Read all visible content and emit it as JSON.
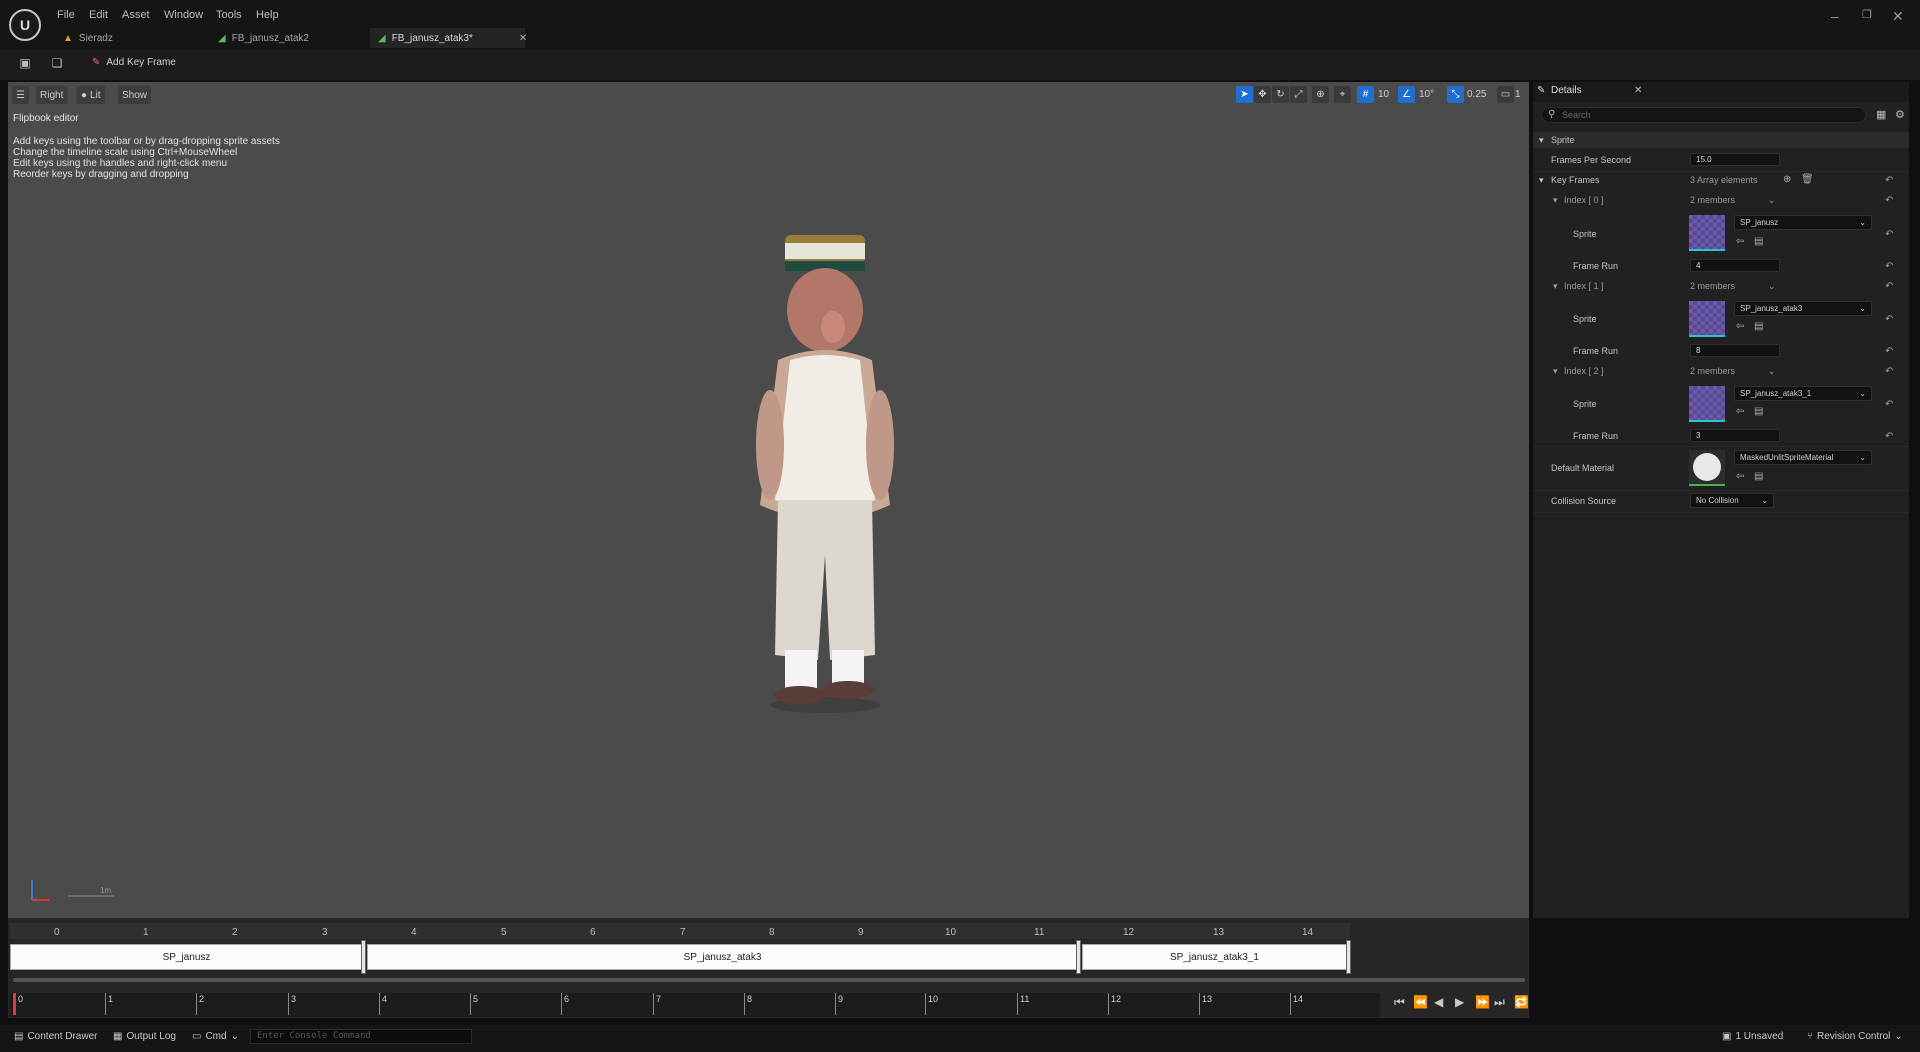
{
  "menu": [
    "File",
    "Edit",
    "Asset",
    "Window",
    "Tools",
    "Help"
  ],
  "tabs": [
    {
      "label": "Sieradz",
      "icon": "level-icon"
    },
    {
      "label": "FB_janusz_atak2",
      "icon": "flipbook-icon"
    },
    {
      "label": "FB_janusz_atak3*",
      "icon": "flipbook-icon",
      "active": true
    }
  ],
  "toolbar": {
    "add_key_frame": "Add Key Frame"
  },
  "viewport": {
    "view_mode": "Right",
    "lighting": "Lit",
    "show": "Show",
    "grid_snap": "10",
    "rotation_snap": "10°",
    "scale_snap": "0.25",
    "camera_speed": "1",
    "title": "Flipbook editor",
    "help_lines": [
      "Add keys using the toolbar or by drag-dropping sprite assets",
      "Change the timeline scale using Ctrl+MouseWheel",
      "Edit keys using the handles and right-click menu",
      "Reorder keys by dragging and dropping"
    ],
    "scale_label": "1m"
  },
  "details": {
    "title": "Details",
    "search_placeholder": "Search",
    "category": "Sprite",
    "fps_label": "Frames Per Second",
    "fps_value": "15.0",
    "key_frames_label": "Key Frames",
    "key_frames_count": "3 Array elements",
    "members": "2 members",
    "sprite_label": "Sprite",
    "frame_run_label": "Frame Run",
    "entries": [
      {
        "index": "Index [ 0 ]",
        "sprite": "SP_janusz",
        "frame_run": "4"
      },
      {
        "index": "Index [ 1 ]",
        "sprite": "SP_janusz_atak3",
        "frame_run": "8"
      },
      {
        "index": "Index [ 2 ]",
        "sprite": "SP_janusz_atak3_1",
        "frame_run": "3"
      }
    ],
    "default_material_label": "Default Material",
    "default_material_value": "MaskedUnlitSpriteMaterial",
    "collision_label": "Collision Source",
    "collision_value": "No Collision"
  },
  "timeline": {
    "frames": [
      "0",
      "1",
      "2",
      "3",
      "4",
      "5",
      "6",
      "7",
      "8",
      "9",
      "10",
      "11",
      "12",
      "13",
      "14"
    ],
    "keys": [
      "SP_janusz",
      "SP_janusz_atak3",
      "SP_janusz_atak3_1"
    ],
    "ruler": [
      "0",
      "1",
      "2",
      "3",
      "4",
      "5",
      "6",
      "7",
      "8",
      "9",
      "10",
      "11",
      "12",
      "13",
      "14"
    ]
  },
  "status": {
    "content_drawer": "Content Drawer",
    "output_log": "Output Log",
    "cmd": "Cmd",
    "console_placeholder": "Enter Console Command",
    "unsaved": "1 Unsaved",
    "revision_control": "Revision Control"
  }
}
